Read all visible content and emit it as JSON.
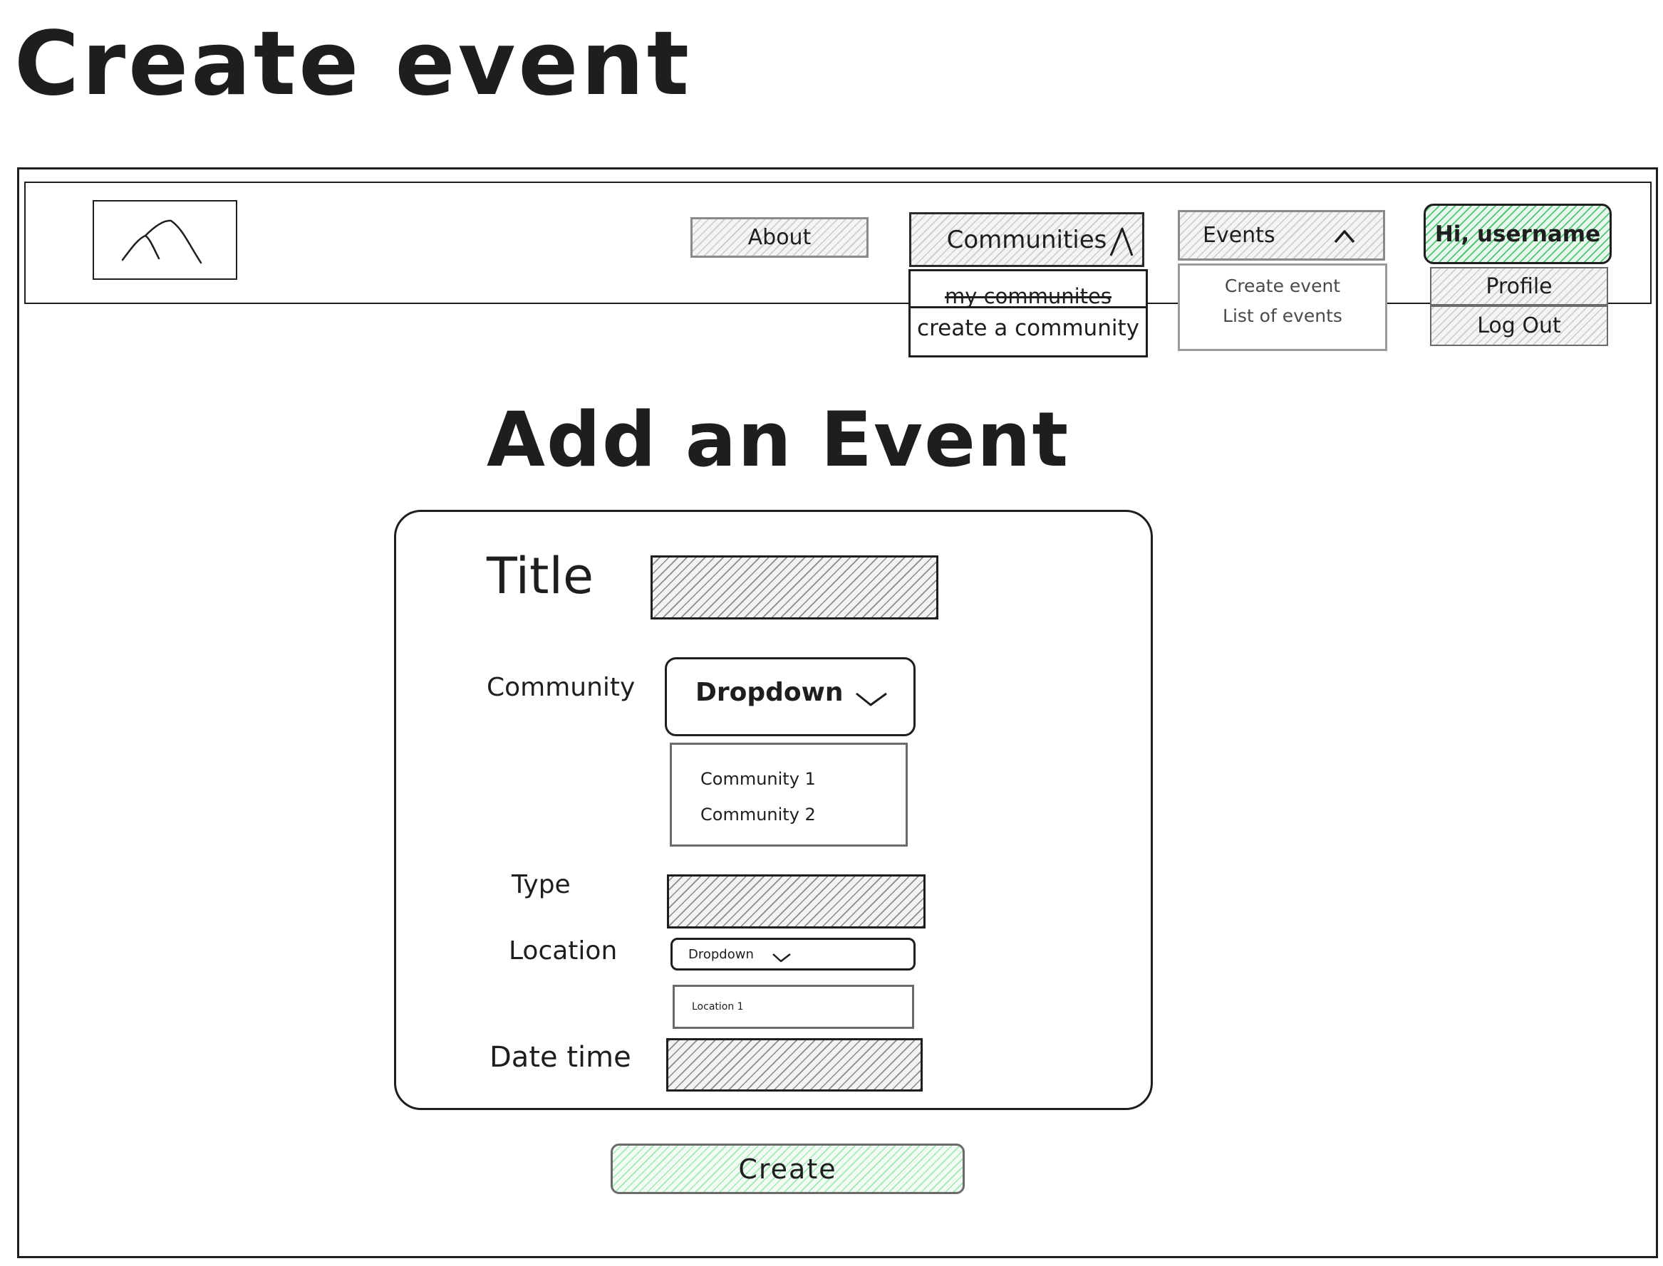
{
  "page_heading": "Create event",
  "nav": {
    "about": "About",
    "communities": {
      "label": "Communities",
      "items": [
        "my communites",
        "create a community"
      ]
    },
    "events": {
      "label": "Events",
      "items": [
        "Create event",
        "List of events"
      ]
    },
    "user": {
      "label": "Hi, username",
      "items": [
        "Profile",
        "Log Out"
      ]
    }
  },
  "form": {
    "heading": "Add an Event",
    "title_label": "Title",
    "community_label": "Community",
    "community_dropdown": "Dropdown",
    "community_options": [
      "Community 1",
      "Community 2"
    ],
    "type_label": "Type",
    "location_label": "Location",
    "location_dropdown": "Dropdown",
    "location_options": [
      "Location 1"
    ],
    "datetime_label": "Date time",
    "submit": "Create"
  },
  "icons": [
    "logo-mountains-icon",
    "chevron-up-icon",
    "chevron-down-icon"
  ],
  "colors": {
    "ink": "#1e1e1e",
    "hatch_grey": "#c9c9c9",
    "hatch_green": "#57c07a"
  }
}
